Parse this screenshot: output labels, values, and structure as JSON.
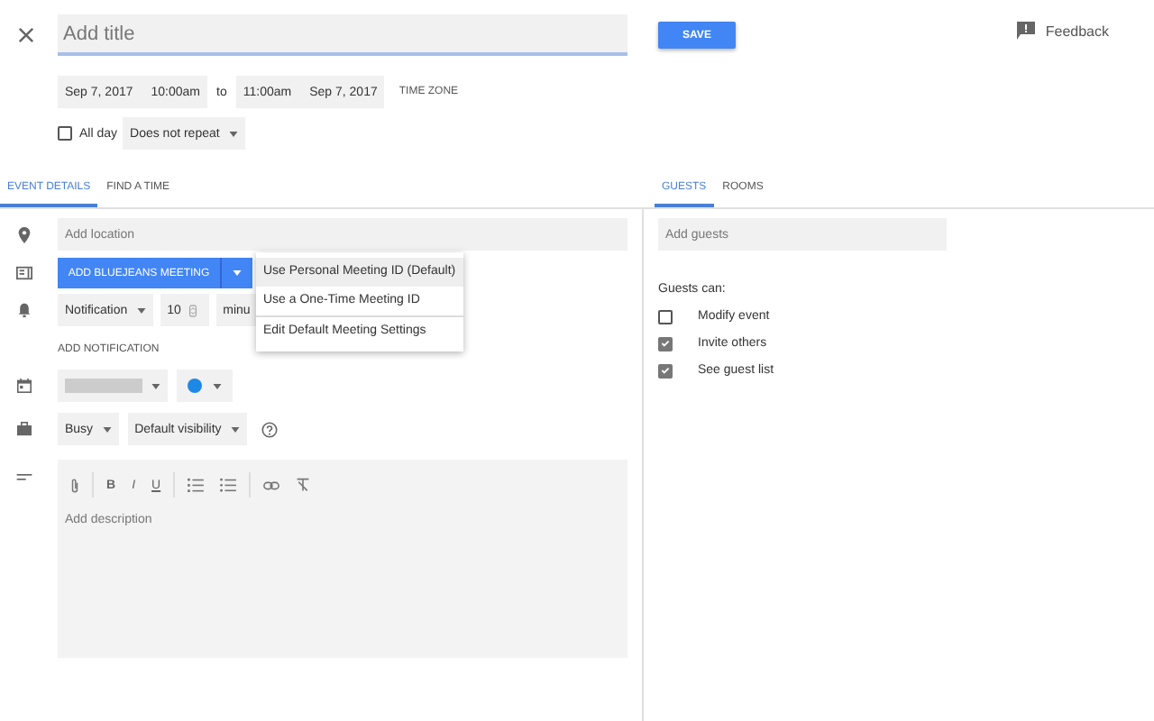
{
  "title_field": {
    "placeholder": "Add title"
  },
  "save_button": "SAVE",
  "feedback": "Feedback",
  "date_time": {
    "start_date": "Sep 7, 2017",
    "start_time": "10:00am",
    "separator": "to",
    "end_time": "11:00am",
    "end_date": "Sep 7, 2017",
    "time_zone": "TIME ZONE"
  },
  "all_day": {
    "label": "All day",
    "checked": false
  },
  "repeat": "Does not repeat",
  "left_tabs": [
    {
      "label": "EVENT DETAILS",
      "selected": true
    },
    {
      "label": "FIND A TIME",
      "selected": false
    }
  ],
  "location": {
    "placeholder": "Add location"
  },
  "meeting_button": "ADD BLUEJEANS MEETING",
  "meeting_menu": [
    {
      "label": "Use Personal Meeting ID (Default)",
      "selected": true
    },
    {
      "label": "Use a One-Time Meeting ID",
      "selected": false
    },
    {
      "label": "Edit Default Meeting Settings",
      "selected": false
    }
  ],
  "notification": {
    "type": "Notification",
    "amount": "10",
    "unit": "minu"
  },
  "add_notification": "ADD NOTIFICATION",
  "availability": "Busy",
  "visibility": "Default visibility",
  "format_buttons": [
    {
      "kind": "attach"
    },
    {
      "kind": "bold",
      "glyph": "B"
    },
    {
      "kind": "italic",
      "glyph": "I"
    },
    {
      "kind": "underline",
      "glyph": "U"
    },
    {
      "kind": "numbered-list"
    },
    {
      "kind": "bulleted-list"
    },
    {
      "kind": "link"
    },
    {
      "kind": "clear-format"
    }
  ],
  "description": {
    "placeholder": "Add description"
  },
  "right_tabs": [
    {
      "label": "GUESTS",
      "selected": true
    },
    {
      "label": "ROOMS",
      "selected": false
    }
  ],
  "guests": {
    "placeholder": "Add guests"
  },
  "guests_can": "Guests can:",
  "permissions": [
    {
      "label": "Modify event",
      "checked": false
    },
    {
      "label": "Invite others",
      "checked": true
    },
    {
      "label": "See guest list",
      "checked": true
    }
  ]
}
